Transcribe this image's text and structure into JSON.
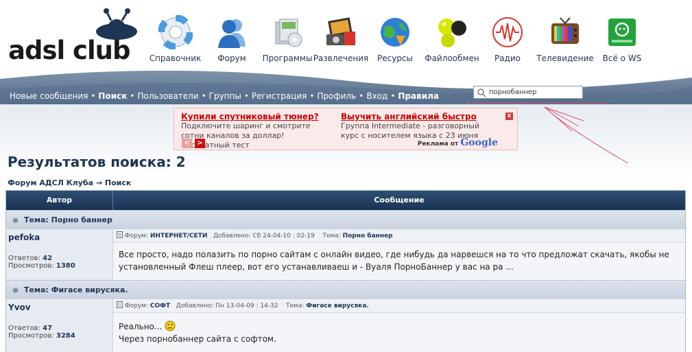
{
  "logo": {
    "text": "adsl club"
  },
  "topnav": [
    {
      "label": "Справочник",
      "icon": "lifebuoy-icon"
    },
    {
      "label": "Форум",
      "icon": "user-icon"
    },
    {
      "label": "Программы",
      "icon": "software-box-icon"
    },
    {
      "label": "Развлечения",
      "icon": "media-icon"
    },
    {
      "label": "Ресурсы",
      "icon": "globe-icon"
    },
    {
      "label": "Файлообмен",
      "icon": "balls-icon"
    },
    {
      "label": "Радио",
      "icon": "radio-wave-icon"
    },
    {
      "label": "Телевидение",
      "icon": "tv-icon"
    },
    {
      "label": "Всё о WS",
      "icon": "ws-icon"
    }
  ],
  "subnav": {
    "new_messages": "Новые сообщения",
    "search": "Поиск",
    "users": "Пользователи",
    "groups": "Группы",
    "register": "Регистрация",
    "profile": "Профиль",
    "login": "Вход",
    "rules": "Правила",
    "separator": "•"
  },
  "search": {
    "value": "порнобаннер"
  },
  "ad": {
    "left_title": "Купили спутниковый тюнер?",
    "left_text": "Подключите шаринг и смотрите сотни каналов за доллар! Бесплатный тест",
    "right_title": "Выучить английский быстро",
    "right_text": "Группа Intermediate - разговорный курс с носителем языка с 23 июня",
    "ads_by": "Реклама от",
    "google": "Google",
    "close": "x",
    "prev": "<",
    "next": ">"
  },
  "page_title": "Результатов поиска: 2",
  "breadcrumb": "Форум АДСЛ Клуба → Поиск",
  "table": {
    "col_author": "Автор",
    "col_message": "Сообщение"
  },
  "results": [
    {
      "topic": "Тема: Порно баннер",
      "author": "pefoka",
      "replies_label": "Ответов:",
      "replies": "42",
      "views_label": "Просмотров:",
      "views": "1380",
      "meta_forum_label": "Форум:",
      "meta_forum": "ИНТЕРНЕТ/СЕТИ",
      "meta_added": "Добавлено: Сб 24-04-10 : 02-19",
      "meta_topic_label": "Тема:",
      "meta_topic": "Порно баннер",
      "body": "Все просто, надо полазить по порно сайтам с онлайн видео, где нибудь да нарвешся на то что предложат скачать, якобы не установленный Флеш плеер, вот его устанавливаеш и - Вуаля ПорноБаннер у вас на ра ..."
    },
    {
      "topic": "Тема: Фигасе вирусяка.",
      "author": "Yvov",
      "replies_label": "Ответов:",
      "replies": "47",
      "views_label": "Просмотров:",
      "views": "3284",
      "meta_forum_label": "Форум:",
      "meta_forum": "СОФТ",
      "meta_added": "Добавлено: Пн 13-04-09 : 14-32",
      "meta_topic_label": "Тема:",
      "meta_topic": "Фигасе вирусяка.",
      "body_line1": "Реально...",
      "body_line2": "Через порнобаннер сайта с софтом."
    }
  ]
}
